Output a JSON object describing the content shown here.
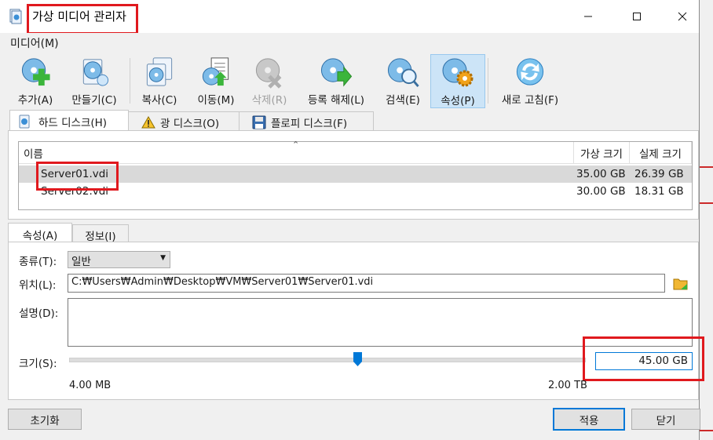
{
  "window": {
    "title": "가상 미디어 관리자"
  },
  "menu": {
    "media": "미디어(M)"
  },
  "toolbar": [
    {
      "label": "추가(A)",
      "icon": "add-icon"
    },
    {
      "label": "만들기(C)",
      "icon": "create-icon"
    },
    {
      "label": "복사(C)",
      "icon": "copy-icon"
    },
    {
      "label": "이동(M)",
      "icon": "move-icon"
    },
    {
      "label": "삭제(R)",
      "icon": "remove-icon",
      "disabled": true
    },
    {
      "label": "등록 해제(L)",
      "icon": "release-icon"
    },
    {
      "label": "검색(E)",
      "icon": "search-icon"
    },
    {
      "label": "속성(P)",
      "icon": "properties-icon",
      "active": true
    },
    {
      "label": "새로 고침(F)",
      "icon": "refresh-icon"
    }
  ],
  "media_tabs": [
    {
      "label": "하드 디스크(H)",
      "icon": "hard-disk-icon"
    },
    {
      "label": "광 디스크(O)",
      "icon": "warning-icon"
    },
    {
      "label": "플로피 디스크(F)",
      "icon": "floppy-icon"
    }
  ],
  "table": {
    "headers": [
      "이름",
      "가상 크기",
      "실제 크기"
    ],
    "rows": [
      {
        "name": "Server01.vdi",
        "virtual": "35.00 GB",
        "actual": "26.39 GB"
      },
      {
        "name": "Server02.vdi",
        "virtual": "30.00 GB",
        "actual": "18.31 GB"
      }
    ]
  },
  "prop_tabs": [
    "속성(A)",
    "정보(I)"
  ],
  "properties": {
    "type_label": "종류(T):",
    "type_value": "일반",
    "location_label": "위치(L):",
    "location_value": "C:₩Users₩Admin₩Desktop₩VM₩Server01₩Server01.vdi",
    "description_label": "설명(D):",
    "description_value": "",
    "size_label": "크기(S):",
    "size_value": "45.00 GB",
    "size_min": "4.00 MB",
    "size_max": "2.00 TB",
    "slider_fraction": 0.56
  },
  "buttons": {
    "reset": "초기화",
    "apply": "적용",
    "close": "닫기"
  },
  "colors": {
    "accent": "#0078d7",
    "highlight": "#e0191e",
    "selected_row": "#d9d9d9"
  }
}
